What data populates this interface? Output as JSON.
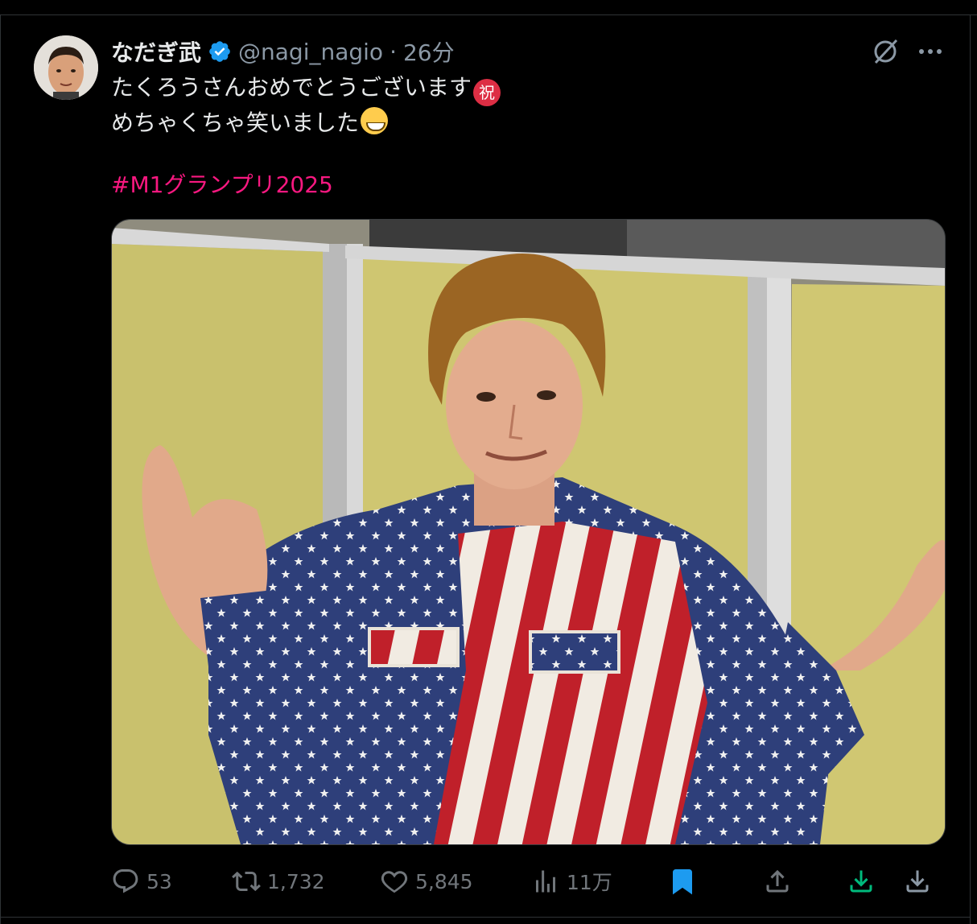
{
  "post": {
    "display_name": "なだぎ武",
    "handle": "@nagi_nagio",
    "separator": "·",
    "time": "26分",
    "text_line1": "たくろうさんおめでとうございます",
    "emoji_iwai": "祝",
    "text_line2": "めちゃくちゃ笑いました",
    "hashtag": "#M1グランプリ2025"
  },
  "actions": {
    "replies": "53",
    "reposts": "1,732",
    "likes": "5,845",
    "views": "11万"
  },
  "colors": {
    "background": "#000000",
    "text": "#e7e9ea",
    "muted": "#71767b",
    "verified": "#1d9bf0",
    "hashtag": "#f91880",
    "bookmark_active": "#1d9bf0",
    "download_green": "#00ba7c"
  },
  "icons": [
    "verified-badge-icon",
    "grok-icon",
    "more-icon",
    "reply-icon",
    "repost-icon",
    "like-icon",
    "views-icon",
    "bookmark-icon",
    "share-icon",
    "download-icon",
    "download-alt-icon"
  ]
}
